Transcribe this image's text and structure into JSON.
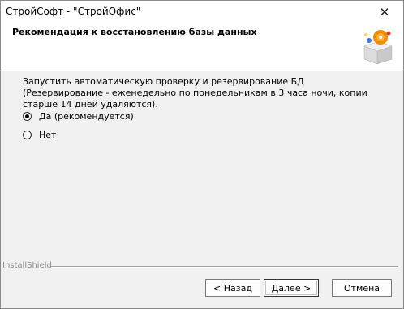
{
  "window": {
    "title": "СтройСофт - \"СтройОфис\"",
    "close_label": "✕"
  },
  "header": {
    "title": "Рекомендация к восстановлению базы данных",
    "logo_icon": "setup-box-icon"
  },
  "content": {
    "description": "Запустить автоматическую проверку и резервирование БД (Резервирование - еженедельно по понедельникам в 3 часа ночи, копии старше 14 дней удаляются).",
    "options": [
      {
        "label": "Да (рекомендуется)",
        "selected": true
      },
      {
        "label": "Нет",
        "selected": false
      }
    ]
  },
  "footer": {
    "brand": "InstallShield",
    "buttons": {
      "back": "< Назад",
      "next": "Далее >",
      "cancel": "Отмена"
    }
  }
}
